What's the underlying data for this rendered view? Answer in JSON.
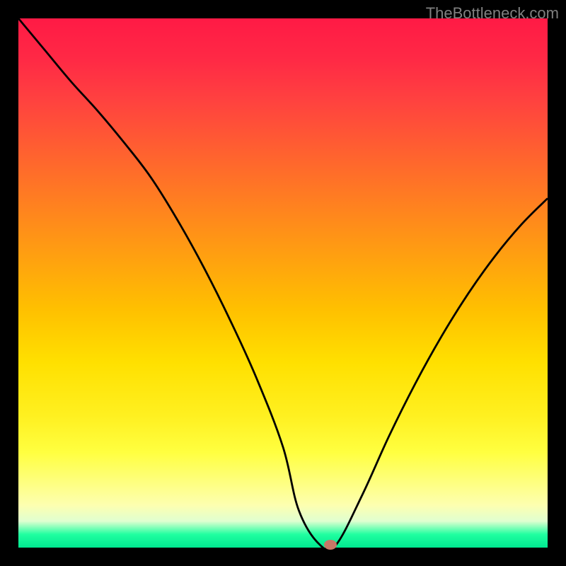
{
  "watermark": "TheBottleneck.com",
  "chart_data": {
    "type": "line",
    "title": "",
    "xlabel": "",
    "ylabel": "",
    "xlim": [
      0,
      100
    ],
    "ylim": [
      0,
      100
    ],
    "x": [
      0,
      5,
      10,
      15,
      20,
      25,
      30,
      35,
      40,
      45,
      50,
      53,
      57,
      60,
      65,
      70,
      75,
      80,
      85,
      90,
      95,
      100
    ],
    "values": [
      100,
      94,
      88,
      82.5,
      76.5,
      70,
      62,
      53,
      43,
      32,
      19,
      7,
      0.5,
      0.5,
      10,
      21,
      31,
      40,
      48,
      55,
      61,
      66
    ],
    "marker": {
      "x": 59,
      "y": 0.5
    },
    "background": "heat-gradient"
  }
}
